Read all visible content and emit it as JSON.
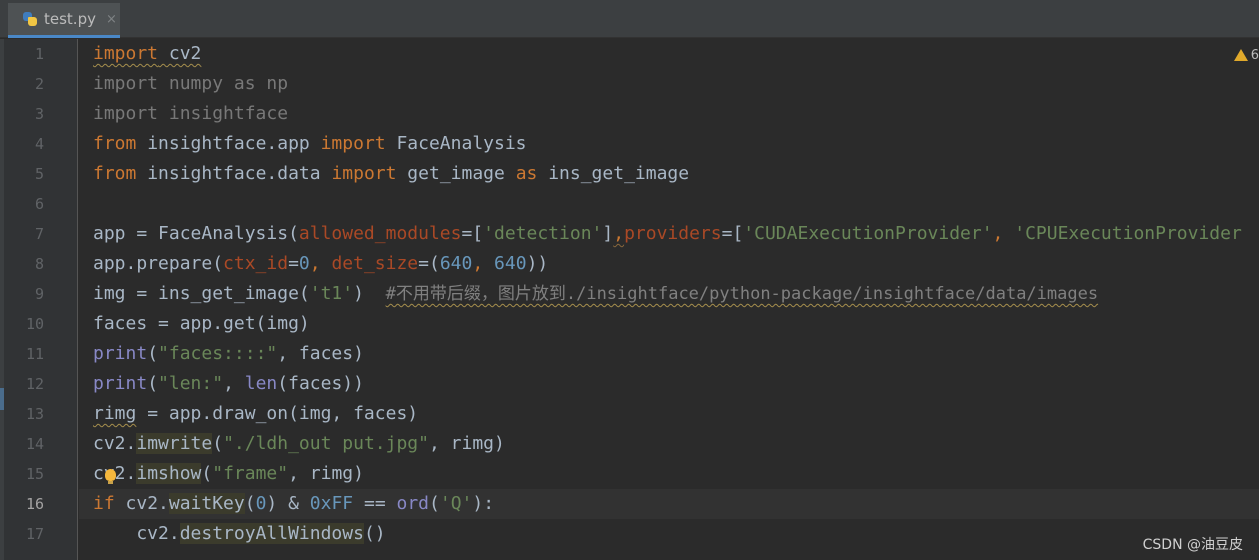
{
  "tab": {
    "filename": "test.py",
    "close": "×"
  },
  "warnings": {
    "count": "6"
  },
  "line_numbers": [
    "1",
    "2",
    "3",
    "4",
    "5",
    "6",
    "7",
    "8",
    "9",
    "10",
    "11",
    "12",
    "13",
    "14",
    "15",
    "16",
    "17"
  ],
  "code": {
    "l1": {
      "a": "import",
      "b": " cv2"
    },
    "l2": {
      "a": "import numpy as np"
    },
    "l3": {
      "a": "import insightface"
    },
    "l4": {
      "a": "from",
      "b": " insightface.app ",
      "c": "import",
      "d": " FaceAnalysis"
    },
    "l5": {
      "a": "from",
      "b": " insightface.data ",
      "c": "import",
      "d": " get_image ",
      "e": "as",
      "f": " ins_get_image"
    },
    "l7": {
      "a": "app = FaceAnalysis(",
      "b": "allowed_modules",
      "c": "=[",
      "d": "'detection'",
      "e": "]",
      "f": ",",
      "g": "providers",
      "h": "=[",
      "i": "'CUDAExecutionProvider'",
      "j": ", ",
      "k": "'CPUExecutionProvider"
    },
    "l8": {
      "a": "app.prepare(",
      "b": "ctx_id",
      "c": "=",
      "d": "0",
      "e": ", ",
      "f": "det_size",
      "g": "=(",
      "h": "640",
      "i": ", ",
      "j": "640",
      "k": "))"
    },
    "l9": {
      "a": "img = ins_get_image(",
      "b": "'t1'",
      "c": ")  ",
      "d": "#不用带后缀，图片放到./insightface/python-package/insightface/data/images"
    },
    "l10": {
      "a": "faces = app.get(img)"
    },
    "l11": {
      "a": "print",
      "b": "(",
      "c": "\"faces::::\"",
      "d": ", faces)"
    },
    "l12": {
      "a": "print",
      "b": "(",
      "c": "\"len:\"",
      "d": ", ",
      "e": "len",
      "f": "(faces))"
    },
    "l13": {
      "a": "rimg",
      "b": " = app.draw_on(img, faces)"
    },
    "l14": {
      "a": "cv2.",
      "b": "imwrite",
      "c": "(",
      "d": "\"./ldh_out put.jpg\"",
      "e": ", rimg)"
    },
    "l15": {
      "a": "cv2.",
      "b": "imshow",
      "c": "(",
      "d": "\"frame\"",
      "e": ", rimg)"
    },
    "l16": {
      "a": "if",
      "b": " cv2.",
      "c": "waitKey",
      "d": "(",
      "e": "0",
      "f": ") & ",
      "g": "0xFF",
      "h": " == ",
      "i": "ord",
      "j": "(",
      "k": "'Q'",
      "l": "):"
    },
    "l17": {
      "a": "    cv2.",
      "b": "destroyAllWindows",
      "c": "()"
    }
  },
  "watermark": "CSDN @油豆皮"
}
